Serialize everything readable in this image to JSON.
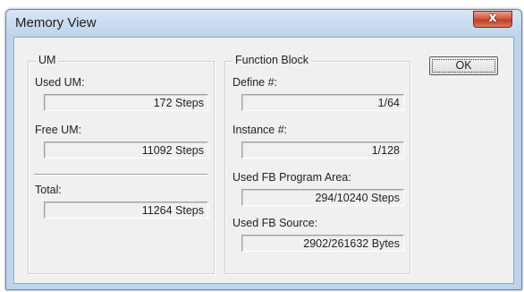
{
  "window": {
    "title": "Memory View",
    "close_label": "x"
  },
  "um_group": {
    "legend": "UM",
    "used_label": "Used UM:",
    "used_value": "172 Steps",
    "free_label": "Free UM:",
    "free_value": "11092 Steps",
    "total_label": "Total:",
    "total_value": "11264 Steps"
  },
  "fb_group": {
    "legend": "Function Block",
    "define_label": "Define #:",
    "define_value": "1/64",
    "instance_label": "Instance #:",
    "instance_value": "1/128",
    "program_area_label": "Used FB Program Area:",
    "program_area_value": "294/10240 Steps",
    "source_label": "Used FB Source:",
    "source_value": "2902/261632 Bytes"
  },
  "buttons": {
    "ok_label": "OK"
  }
}
